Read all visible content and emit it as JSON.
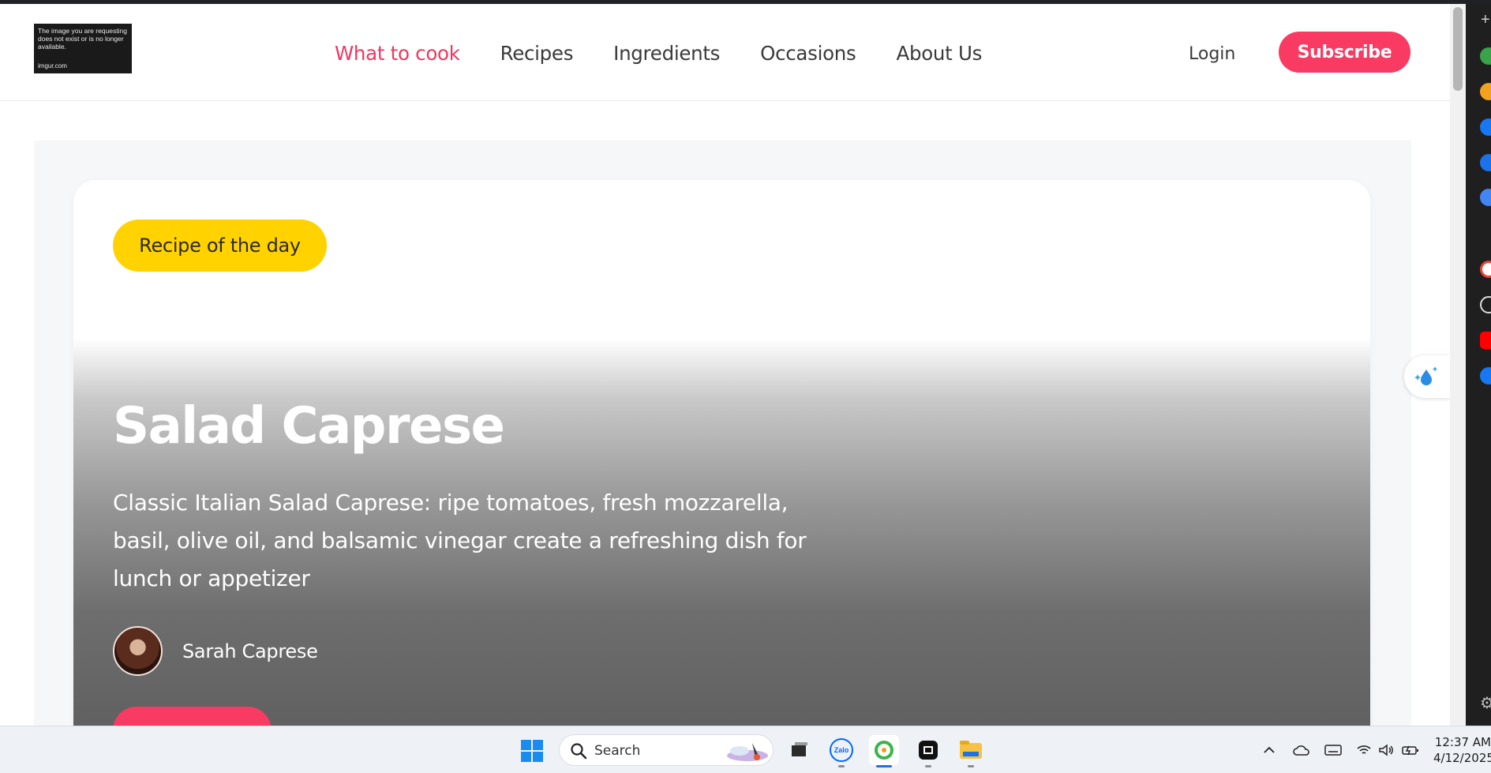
{
  "header": {
    "logo": {
      "line1": "The image you are requesting does not exist or is no longer available.",
      "line2": "imgur.com"
    },
    "nav": [
      {
        "label": "What to cook",
        "active": true
      },
      {
        "label": "Recipes",
        "active": false
      },
      {
        "label": "Ingredients",
        "active": false
      },
      {
        "label": "Occasions",
        "active": false
      },
      {
        "label": "About Us",
        "active": false
      }
    ],
    "login_label": "Login",
    "subscribe_label": "Subscribe"
  },
  "hero": {
    "badge": "Recipe of the day",
    "title": "Salad Caprese",
    "description": "Classic Italian Salad Caprese: ripe tomatoes, fresh mozzarella, basil, olive oil, and balsamic vinegar create a refreshing dish for lunch or appetizer",
    "author": "Sarah Caprese"
  },
  "taskbar": {
    "search_placeholder": "Search",
    "time": "12:37 AM",
    "date": "4/12/2025",
    "apps": [
      "start-icon",
      "task-view-icon",
      "zalo-icon",
      "coccoc-browser-icon",
      "capcut-icon",
      "file-explorer-icon"
    ],
    "tray": [
      "chevron-up-icon",
      "cloud-icon",
      "keyboard-icon",
      "wifi-icon",
      "volume-icon",
      "battery-icon"
    ]
  },
  "colors": {
    "accent": "#f93a62",
    "badge": "#ffd200",
    "nav_active": "#f0365e"
  }
}
